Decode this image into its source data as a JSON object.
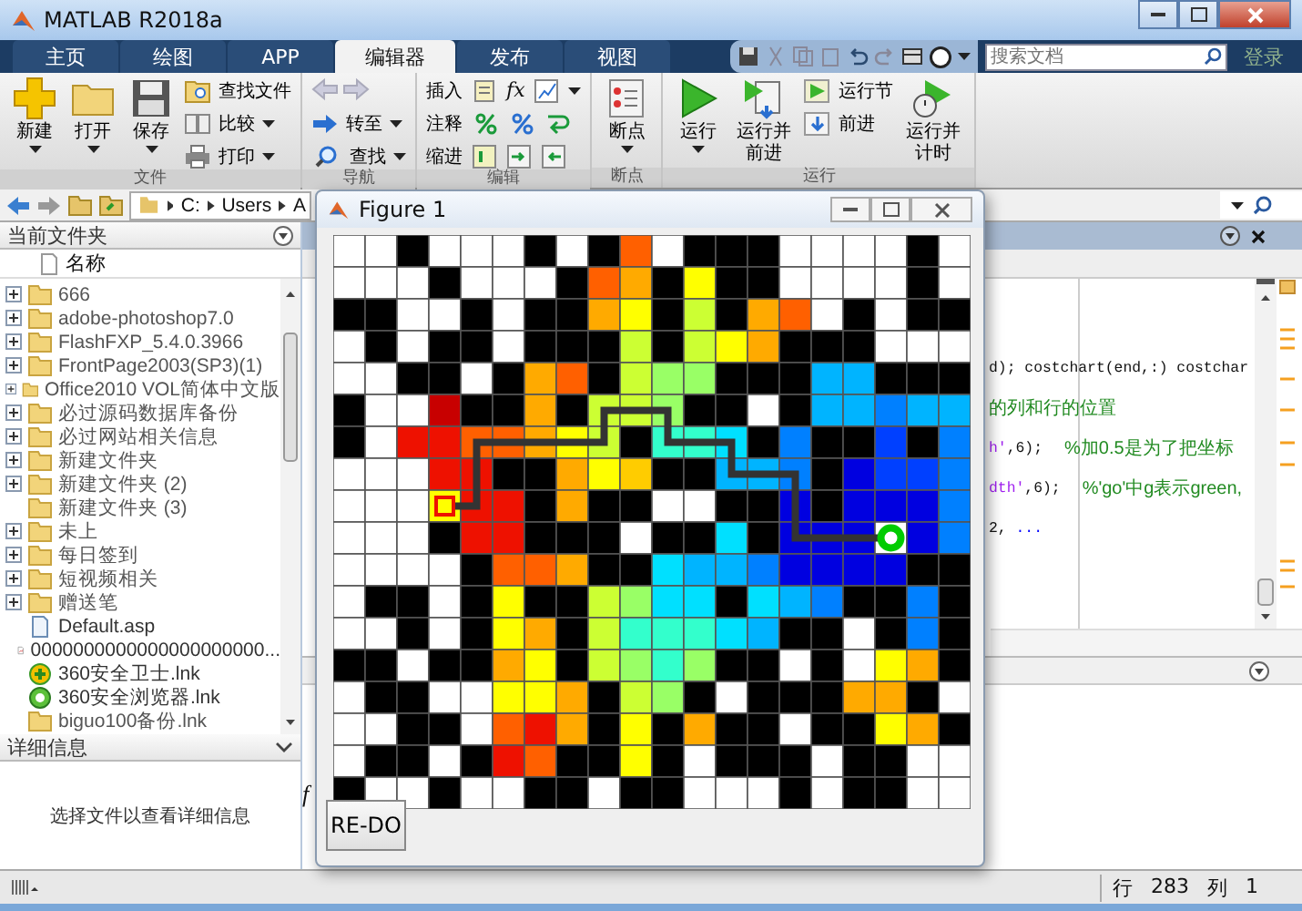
{
  "window": {
    "title": "MATLAB R2018a"
  },
  "tabs": [
    {
      "label": "主页",
      "selected": false
    },
    {
      "label": "绘图",
      "selected": false
    },
    {
      "label": "APP",
      "selected": false
    },
    {
      "label": "编辑器",
      "selected": true
    },
    {
      "label": "发布",
      "selected": false
    },
    {
      "label": "视图",
      "selected": false
    }
  ],
  "search": {
    "placeholder": "搜索文档"
  },
  "sign_in": "登录",
  "ribbon": [
    {
      "title": "文件",
      "items": [
        {
          "label": "新建",
          "kind": "large",
          "dropdown": true
        },
        {
          "label": "打开",
          "kind": "large",
          "dropdown": true
        },
        {
          "label": "保存",
          "kind": "large",
          "dropdown": true
        },
        {
          "label": "查找文件",
          "kind": "small",
          "dropdown": false
        },
        {
          "label": "比较",
          "kind": "small",
          "dropdown": true
        },
        {
          "label": "打印",
          "kind": "small",
          "dropdown": true
        }
      ]
    },
    {
      "title": "导航",
      "items": [
        {
          "label": "转至",
          "kind": "small",
          "dropdown": true
        },
        {
          "label": "查找",
          "kind": "small",
          "dropdown": true
        }
      ]
    },
    {
      "title": "编辑",
      "function_symbol": "fx",
      "items": [
        {
          "label": "插入",
          "kind": "small",
          "dropdown": false
        },
        {
          "label": "注释",
          "kind": "small",
          "dropdown": false
        },
        {
          "label": "缩进",
          "kind": "small",
          "dropdown": false
        }
      ]
    },
    {
      "title": "断点",
      "items": [
        {
          "label": "断点",
          "kind": "large",
          "dropdown": true
        }
      ]
    },
    {
      "title": "运行",
      "items": [
        {
          "label": "运行",
          "kind": "large",
          "dropdown": true
        },
        {
          "label": "运行并前进",
          "kind": "large",
          "dropdown": false
        },
        {
          "label": "运行节",
          "kind": "small",
          "dropdown": false
        },
        {
          "label": "前进",
          "kind": "small",
          "dropdown": false
        },
        {
          "label": "运行并计时",
          "kind": "large",
          "dropdown": false
        }
      ]
    }
  ],
  "address": {
    "path": [
      "C:",
      "Users",
      "A"
    ]
  },
  "current_folder": {
    "title": "当前文件夹",
    "column": "名称",
    "files": [
      {
        "name": "666",
        "kind": "folder",
        "expandable": true
      },
      {
        "name": "adobe-photoshop7.0",
        "kind": "folder",
        "expandable": true
      },
      {
        "name": "FlashFXP_5.4.0.3966",
        "kind": "folder",
        "expandable": true
      },
      {
        "name": "FrontPage2003(SP3)(1)",
        "kind": "folder",
        "expandable": true
      },
      {
        "name": "Office2010 VOL简体中文版",
        "kind": "folder",
        "expandable": true
      },
      {
        "name": "必过源码数据库备份",
        "kind": "folder",
        "expandable": true
      },
      {
        "name": "必过网站相关信息",
        "kind": "folder",
        "expandable": true
      },
      {
        "name": "新建文件夹",
        "kind": "folder",
        "expandable": true
      },
      {
        "name": "新建文件夹 (2)",
        "kind": "folder",
        "expandable": true
      },
      {
        "name": "新建文件夹 (3)",
        "kind": "folder",
        "expandable": false
      },
      {
        "name": "未上",
        "kind": "folder",
        "expandable": true
      },
      {
        "name": "每日签到",
        "kind": "folder",
        "expandable": true
      },
      {
        "name": "短视频相关",
        "kind": "folder",
        "expandable": true
      },
      {
        "name": "赠送笔",
        "kind": "folder",
        "expandable": true
      },
      {
        "name": "Default.asp",
        "kind": "document",
        "expandable": false
      },
      {
        "name": "0000000000000000000000...",
        "kind": "figure",
        "expandable": false
      },
      {
        "name": "360安全卫士.lnk",
        "kind": "shield",
        "expandable": false
      },
      {
        "name": "360安全浏览器.lnk",
        "kind": "browser",
        "expandable": false
      },
      {
        "name": "biguo100备份.lnk",
        "kind": "folder",
        "expandable": false
      }
    ]
  },
  "details": {
    "title": "详细信息",
    "message": "选择文件以查看详细信息"
  },
  "editor": {
    "lines": [
      {
        "segments": [
          {
            "text": "d); costchart(end,:) costchar",
            "kind": "code"
          }
        ]
      },
      {
        "segments": [
          {
            "text": "的列和行的位置",
            "kind": "comment"
          }
        ]
      },
      {
        "segments": [
          {
            "text": "h'",
            "kind": "string"
          },
          {
            "text": ",6);",
            "kind": "code"
          },
          {
            "text": "%加0.5是为了把坐标",
            "kind": "comment"
          }
        ]
      },
      {
        "segments": [
          {
            "text": "dth'",
            "kind": "string"
          },
          {
            "text": ",6);",
            "kind": "code"
          },
          {
            "text": "%'go'中g表示green,",
            "kind": "comment"
          }
        ]
      },
      {
        "segments": [
          {
            "text": "2, ",
            "kind": "code"
          },
          {
            "text": "...",
            "kind": "continuation"
          }
        ]
      }
    ]
  },
  "command_window": {
    "prompt": "f"
  },
  "figure": {
    "title": "Figure 1",
    "button": "RE-DO"
  },
  "status_bar": {
    "row_label": "行",
    "row": "283",
    "col_label": "列",
    "col": "1"
  }
}
